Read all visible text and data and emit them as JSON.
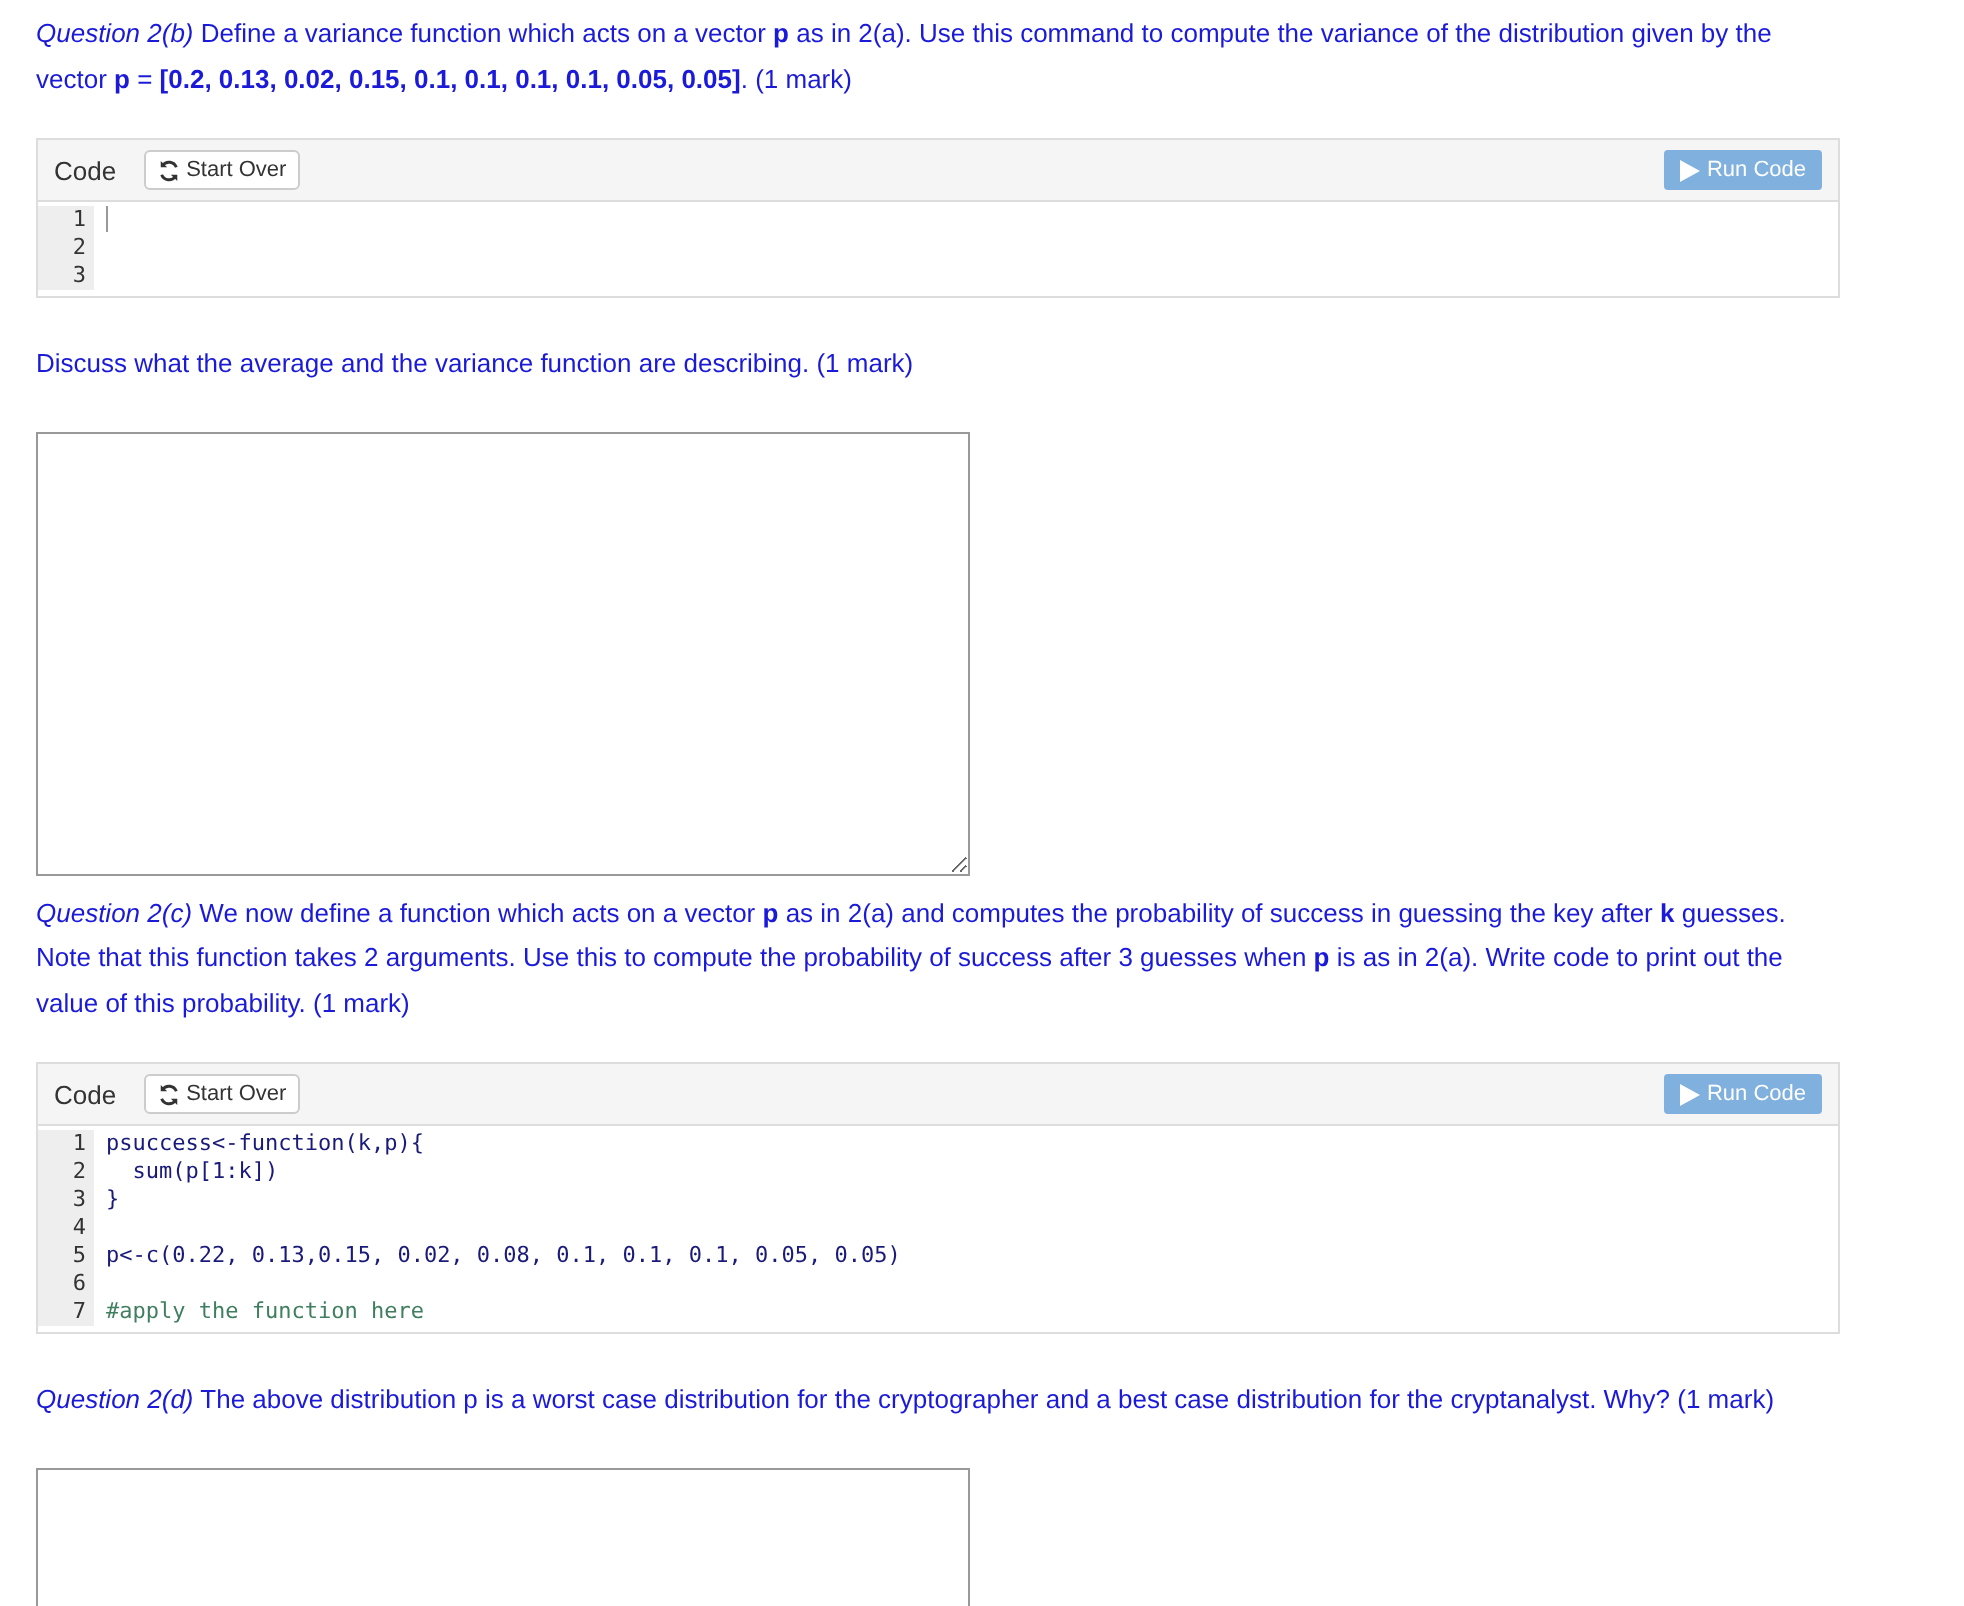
{
  "blocks": [
    {
      "kind": "question",
      "text": "*Question 2(b)* Define a variance function which acts on a vector **p** as in 2(a). Use this command to compute the variance of the distribution given by the vector **p** = **[0.2, 0.13, 0.02, 0.15, 0.1, 0.1, 0.1, 0.1, 0.05, 0.05]**. (1 mark)"
    },
    {
      "kind": "code",
      "label": "Code",
      "start_over": "Start Over",
      "run": "Run Code",
      "lines": [
        {
          "number": "1",
          "kind": "cursor"
        },
        {
          "number": "2",
          "kind": "empty"
        },
        {
          "number": "3",
          "kind": "empty"
        }
      ]
    },
    {
      "kind": "question",
      "text": "Discuss what the average and the variance function are describing. (1 mark)"
    },
    {
      "kind": "answer"
    },
    {
      "kind": "question",
      "text": "*Question 2(c)* We now define a function which acts on a vector **p** as in 2(a) and computes the probability of success in guessing the key after **k** guesses. Note that this function takes 2 arguments. Use this to compute the probability of success after 3 guesses when **p** is as in 2(a). Write code to print out the value of this probability. (1 mark)"
    },
    {
      "kind": "code",
      "label": "Code",
      "start_over": "Start Over",
      "run": "Run Code",
      "lines": [
        {
          "number": "1",
          "text": "psuccess<-function(k,p){",
          "kind": "plain"
        },
        {
          "number": "2",
          "text": "  sum(p[1:k])",
          "kind": "plain"
        },
        {
          "number": "3",
          "text": "}",
          "kind": "plain"
        },
        {
          "number": "4",
          "kind": "empty"
        },
        {
          "number": "5",
          "text": "p<-c(0.22, 0.13,0.15, 0.02, 0.08, 0.1, 0.1, 0.1, 0.05, 0.05)",
          "kind": "plain"
        },
        {
          "number": "6",
          "kind": "empty"
        },
        {
          "number": "7",
          "text": "#apply the function here",
          "kind": "comment"
        }
      ]
    },
    {
      "kind": "question",
      "text": "*Question 2(d)* The above distribution p is a worst case distribution for the cryptographer and a best case distribution for the cryptanalyst. Why? (1 mark)"
    },
    {
      "kind": "answer"
    }
  ]
}
